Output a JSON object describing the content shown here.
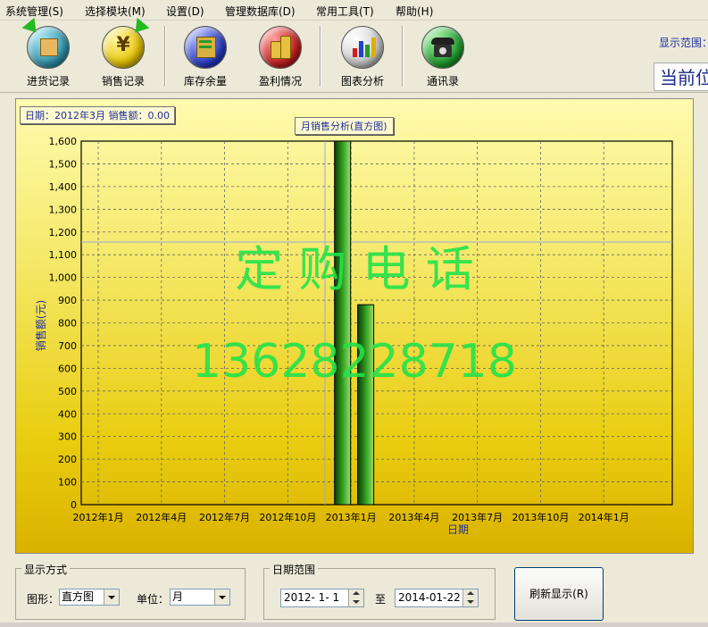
{
  "menu": [
    "系统管理(S)",
    "选择模块(M)",
    "设置(D)",
    "管理数据库(D)",
    "常用工具(T)",
    "帮助(H)"
  ],
  "toolbar": {
    "buttons": [
      {
        "label": "进货记录",
        "icon": "box-in-icon"
      },
      {
        "label": "销售记录",
        "icon": "yen-coin-icon"
      },
      {
        "label": "库存余量",
        "icon": "inventory-icon"
      },
      {
        "label": "盈利情况",
        "icon": "coins-icon"
      },
      {
        "label": "图表分析",
        "icon": "bar-chart-icon"
      },
      {
        "label": "通讯录",
        "icon": "telephone-icon"
      }
    ],
    "range_label": "显示范围：",
    "current_position": "当前位"
  },
  "info": {
    "text": "日期：2012年3月  销售额：0.00"
  },
  "watermark": {
    "line1": "定 购 电 话",
    "line2": "13628228718"
  },
  "chart_data": {
    "type": "bar",
    "title": "月销售分析(直方图)",
    "xlabel": "日期",
    "ylabel": "销售额(元)",
    "ylim": [
      0,
      1600
    ],
    "yticks": [
      "0",
      "100",
      "200",
      "300",
      "400",
      "500",
      "600",
      "700",
      "800",
      "900",
      "1,000",
      "1,100",
      "1,200",
      "1,300",
      "1,400",
      "1,500",
      "1,600"
    ],
    "xticks": [
      "2012年1月",
      "2012年4月",
      "2012年7月",
      "2012年10月",
      "2013年1月",
      "2013年4月",
      "2013年7月",
      "2013年10月",
      "2014年1月"
    ],
    "bars": [
      {
        "label": "2012年12月",
        "month_index": 11.6,
        "value": 1600
      },
      {
        "label": "2013年1月",
        "month_index": 12.7,
        "value": 880
      }
    ],
    "grid": true,
    "colors": {
      "bar": "#2e9e1e",
      "grid": "#666666"
    }
  },
  "controls": {
    "display_group": "显示方式",
    "shape_label": "图形：",
    "shape_value": "直方图",
    "unit_label": "单位：",
    "unit_value": "月",
    "date_group": "日期范围",
    "date_from": "2012- 1- 1",
    "to_label": "至",
    "date_to": "2014-01-22",
    "refresh_label": "刷新显示(R)"
  }
}
